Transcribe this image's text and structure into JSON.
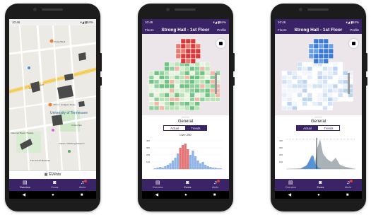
{
  "phone1": {
    "status": {
      "time": "10:46",
      "icons": "▾◢ ▮84%"
    },
    "map_labels": {
      "chase": "Chase Bank",
      "hodges": "John C. Hodges Library",
      "university": "University of Tennessee",
      "circle_park": "Circle Park",
      "mcclung": "Frank H. McClung Museum",
      "fort": "Fort Kid & Lakeshore",
      "cumberland": "Cumberland Ave",
      "clarence": "Clarence Brown Theatre"
    },
    "events_label": "Events",
    "nav": {
      "overview": "Overview",
      "zones": "Zones",
      "alerts": "Alerts"
    }
  },
  "phone2": {
    "status": {
      "time": "10:46",
      "icons": "▾◢ ▮84%"
    },
    "appbar": {
      "left": "Floors",
      "title": "Strong Hall - 1st Floor",
      "right": "Profile"
    },
    "panel": {
      "title": "General",
      "tabs": [
        "Actual",
        "Trends"
      ],
      "selected_tab": "Trends",
      "chart_subtitle": "Live: 250",
      "y_ticks": [
        "400",
        "300",
        "200",
        "100"
      ]
    },
    "nav": {
      "overview": "Overview",
      "zones": "Zones",
      "alerts": "Alerts"
    }
  },
  "phone3": {
    "status": {
      "time": "10:46",
      "icons": "▾◢ ▮84%"
    },
    "appbar": {
      "left": "Floors",
      "title": "Strong Hall - 1st Floor",
      "right": "Profile"
    },
    "panel": {
      "title": "General",
      "tabs": [
        "Actual",
        "Trends"
      ],
      "selected_tab": "Actual",
      "y_ticks": [
        "400",
        "300",
        "200",
        "100"
      ]
    },
    "nav": {
      "overview": "Overview",
      "zones": "Zones",
      "alerts": "Alerts"
    }
  },
  "colors": {
    "primary": "#3a2366",
    "accent_red": "#e53935",
    "heat_red": "#d63a3a",
    "heat_green": "#8fd19e",
    "heat_blue": "#3b7bd4"
  }
}
